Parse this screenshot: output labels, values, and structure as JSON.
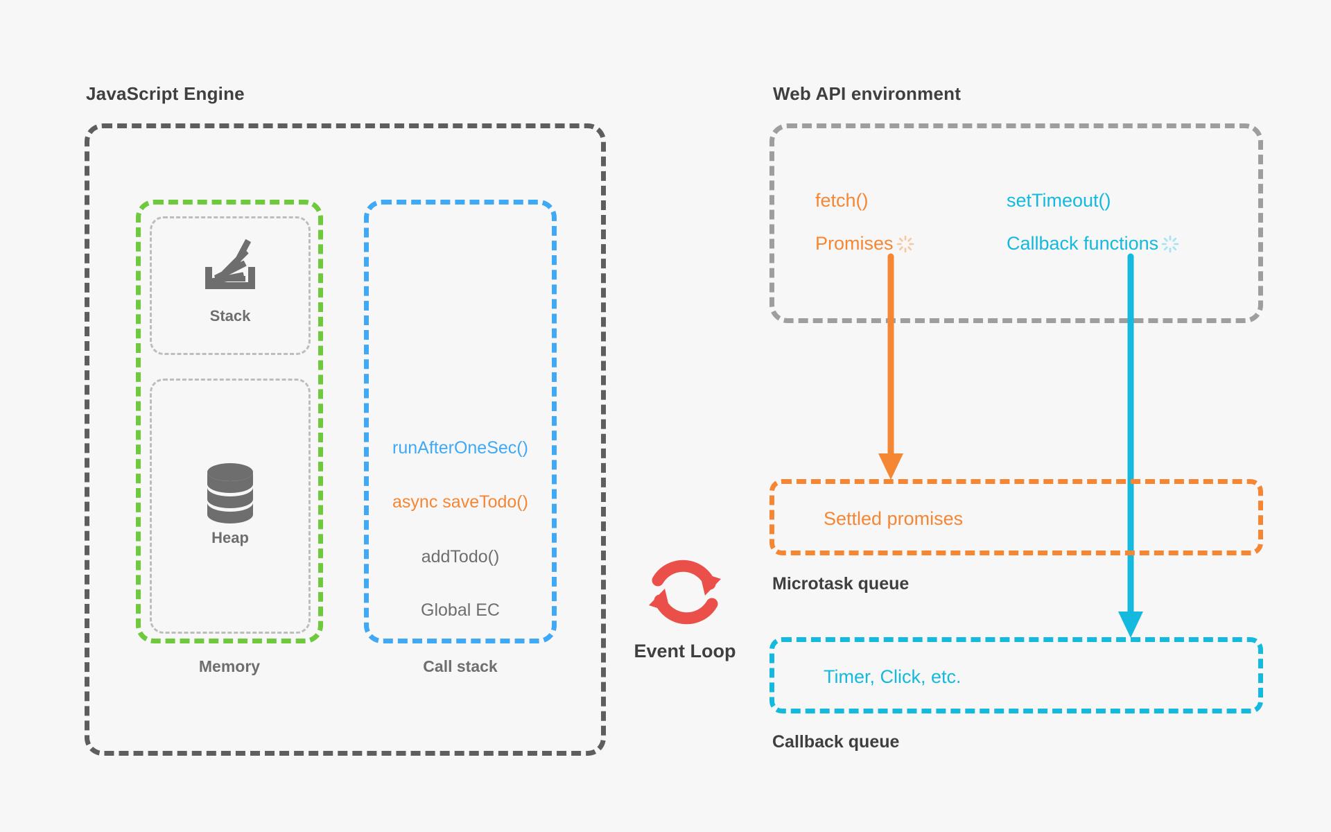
{
  "background": "#F7F7F7",
  "colors": {
    "dark_gray": "#5E5E5E",
    "green": "#6FC93D",
    "blue": "#3FA9F5",
    "orange": "#F58634",
    "cyan": "#14B9DE",
    "red": "#EB4F4A",
    "light_gray": "#BDBDBD",
    "text_gray": "#6E6E6E"
  },
  "js_engine": {
    "title": "JavaScript Engine",
    "memory": {
      "label": "Memory",
      "stack": {
        "icon": "stack-tray-icon",
        "label": "Stack"
      },
      "heap": {
        "icon": "database-cylinder-icon",
        "label": "Heap"
      }
    },
    "call_stack": {
      "label": "Call stack",
      "frames": [
        {
          "text": "runAfterOneSec()",
          "color": "#3FA9F5"
        },
        {
          "text": "async saveTodo()",
          "color": "#F58634"
        },
        {
          "text": "addTodo()",
          "color": "#6E6E6E"
        },
        {
          "text": "Global EC",
          "color": "#6E6E6E"
        }
      ]
    }
  },
  "event_loop": {
    "icon": "circular-refresh-arrows-icon",
    "label": "Event Loop",
    "color": "#EB4F4A"
  },
  "web_api": {
    "title": "Web API environment",
    "items": [
      {
        "text": "fetch()",
        "color": "#F58634",
        "spinner": false,
        "icon": ""
      },
      {
        "text": "setTimeout()",
        "color": "#14B9DE",
        "spinner": false,
        "icon": ""
      },
      {
        "text": "Promises",
        "color": "#F58634",
        "spinner": true,
        "icon": "loading-spinner-icon"
      },
      {
        "text": "Callback functions",
        "color": "#14B9DE",
        "spinner": true,
        "icon": "loading-spinner-icon"
      }
    ]
  },
  "microtask_queue": {
    "label": "Microtask queue",
    "item": "Settled promises",
    "color": "#F58634"
  },
  "callback_queue": {
    "label": "Callback queue",
    "item": "Timer, Click, etc.",
    "color": "#14B9DE"
  },
  "arrows": [
    {
      "name": "promises-to-microtask-arrow",
      "color": "#F58634"
    },
    {
      "name": "callbacks-to-callback-queue-arrow",
      "color": "#14B9DE"
    }
  ]
}
